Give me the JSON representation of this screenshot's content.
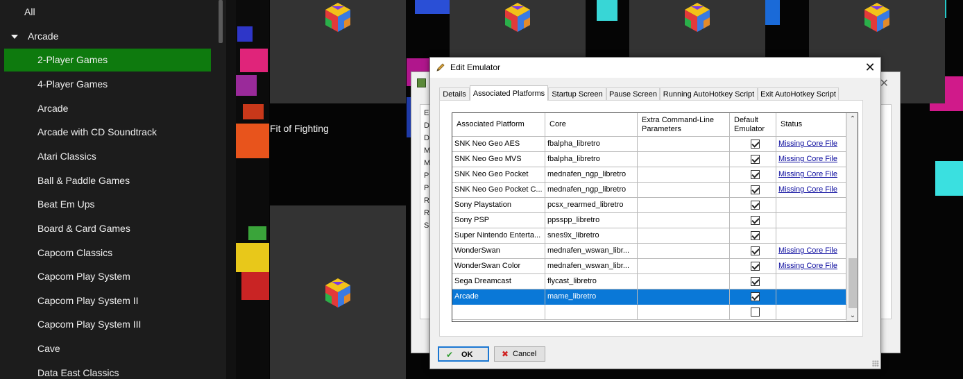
{
  "sidebar": {
    "items": [
      {
        "label": "All"
      },
      {
        "label": "Arcade"
      },
      {
        "label": "2-Player Games"
      },
      {
        "label": "4-Player Games"
      },
      {
        "label": "Arcade"
      },
      {
        "label": "Arcade with CD Soundtrack"
      },
      {
        "label": "Atari Classics"
      },
      {
        "label": "Ball & Paddle Games"
      },
      {
        "label": "Beat Em Ups"
      },
      {
        "label": "Board & Card Games"
      },
      {
        "label": "Capcom Classics"
      },
      {
        "label": "Capcom Play System"
      },
      {
        "label": "Capcom Play System II"
      },
      {
        "label": "Capcom Play System III"
      },
      {
        "label": "Cave"
      },
      {
        "label": "Data East Classics"
      }
    ],
    "selected_label": "2-Player Games"
  },
  "background": {
    "game_title": "Fit of Fighting",
    "behind_letters": [
      "E",
      "D",
      "D",
      "M",
      "M",
      "Pl",
      "P",
      "R",
      "R",
      "S"
    ]
  },
  "dialog": {
    "title": "Edit Emulator",
    "close_glyph": "✕",
    "tabs": [
      {
        "label": "Details"
      },
      {
        "label": "Associated Platforms"
      },
      {
        "label": "Startup Screen"
      },
      {
        "label": "Pause Screen"
      },
      {
        "label": "Running AutoHotkey Script"
      },
      {
        "label": "Exit AutoHotkey Script"
      }
    ],
    "active_tab": "Associated Platforms",
    "columns": [
      "Associated Platform",
      "Core",
      "Extra Command-Line Parameters",
      "Default Emulator",
      "Status"
    ],
    "rows": [
      {
        "platform": "SNK Neo Geo AES",
        "core": "fbalpha_libretro",
        "params": "",
        "default": true,
        "status": "Missing Core File"
      },
      {
        "platform": "SNK Neo Geo MVS",
        "core": "fbalpha_libretro",
        "params": "",
        "default": true,
        "status": "Missing Core File"
      },
      {
        "platform": "SNK Neo Geo Pocket",
        "core": "mednafen_ngp_libretro",
        "params": "",
        "default": true,
        "status": "Missing Core File"
      },
      {
        "platform": "SNK Neo Geo Pocket C...",
        "core": "mednafen_ngp_libretro",
        "params": "",
        "default": true,
        "status": "Missing Core File"
      },
      {
        "platform": "Sony Playstation",
        "core": "pcsx_rearmed_libretro",
        "params": "",
        "default": true,
        "status": ""
      },
      {
        "platform": "Sony PSP",
        "core": "ppsspp_libretro",
        "params": "",
        "default": true,
        "status": ""
      },
      {
        "platform": "Super Nintendo Enterta...",
        "core": "snes9x_libretro",
        "params": "",
        "default": true,
        "status": ""
      },
      {
        "platform": "WonderSwan",
        "core": "mednafen_wswan_libr...",
        "params": "",
        "default": true,
        "status": "Missing Core File"
      },
      {
        "platform": "WonderSwan Color",
        "core": "mednafen_wswan_libr...",
        "params": "",
        "default": true,
        "status": "Missing Core File"
      },
      {
        "platform": "Sega Dreamcast",
        "core": "flycast_libretro",
        "params": "",
        "default": true,
        "status": ""
      },
      {
        "platform": "Arcade",
        "core": "mame_libretro",
        "params": "",
        "default": true,
        "status": "",
        "selected": true
      },
      {
        "platform": "",
        "core": "",
        "params": "",
        "default": false,
        "status": ""
      }
    ],
    "ok_label": "OK",
    "cancel_label": "Cancel",
    "icons": {
      "title": "pencil-icon",
      "ok": "checkmark-icon",
      "cancel": "x-icon"
    }
  },
  "colors": {
    "selection_green": "#0e7a0e",
    "row_selected": "#0a78d7",
    "link": "#0a0a9e"
  }
}
